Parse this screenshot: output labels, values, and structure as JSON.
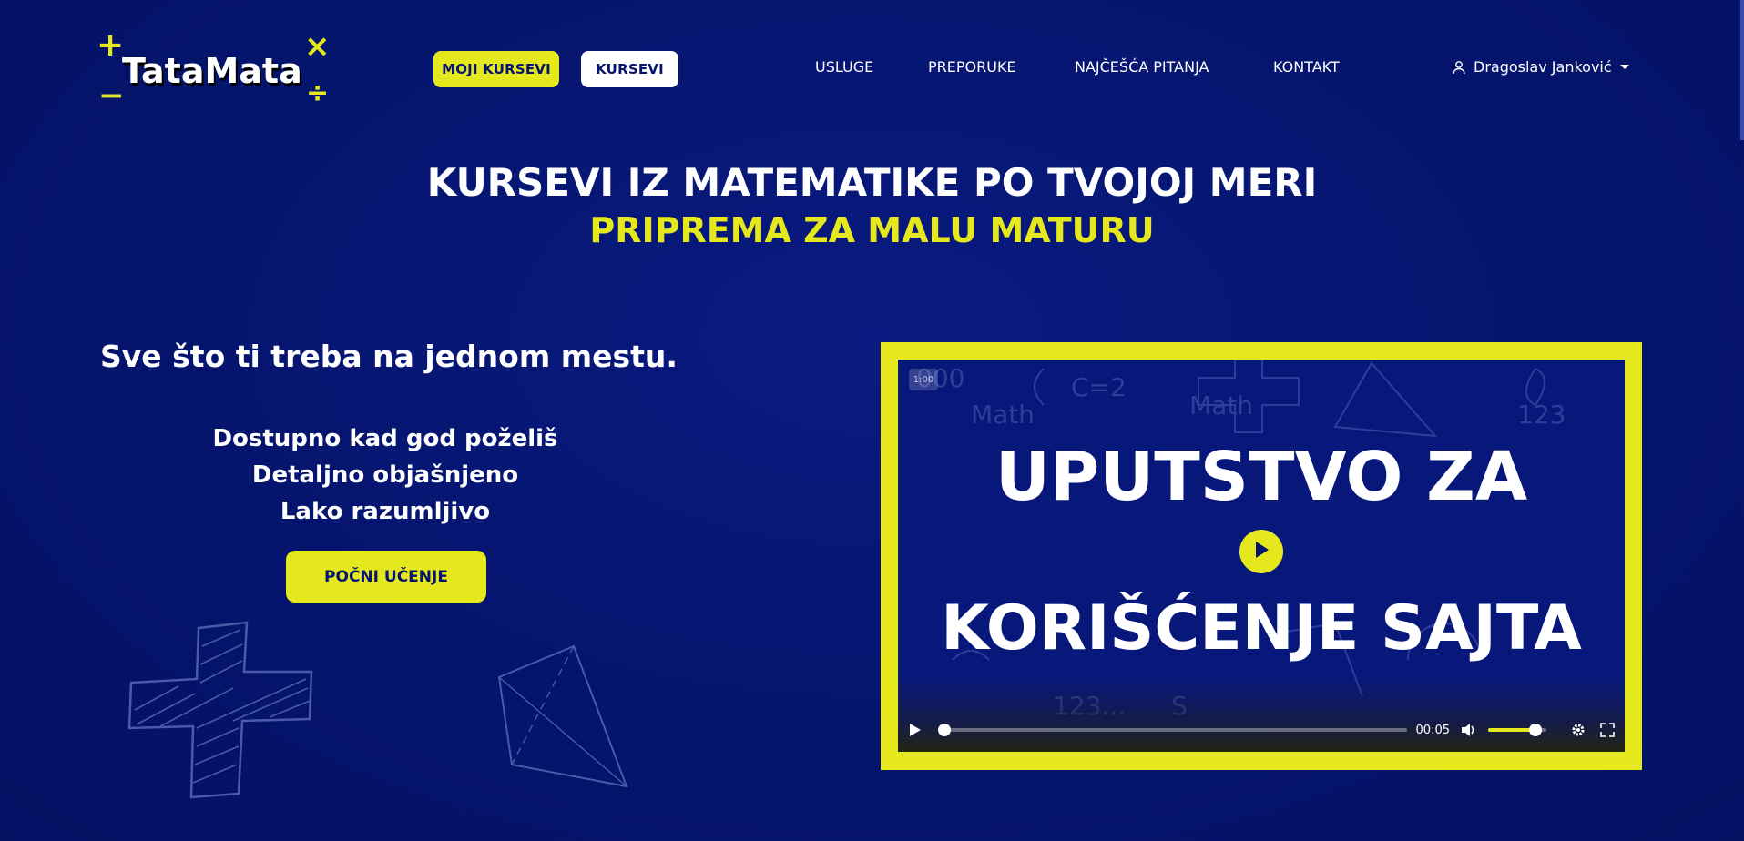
{
  "header": {
    "logo_text": "TataMata",
    "logo_symbols": {
      "plus": "+",
      "minus": "−",
      "times": "×",
      "divide": "÷"
    },
    "buttons": {
      "moji_kursevi": "MOJI KURSEVI",
      "kursevi": "KURSEVI"
    },
    "nav": [
      "USLUGE",
      "PREPORUKE",
      "NAJČEŠĆA PITANJA",
      "KONTAKT"
    ],
    "user_name": "Dragoslav Janković"
  },
  "hero": {
    "title": "KURSEVI IZ MATEMATIKE PO TVOJOJ MERI",
    "subtitle": "PRIPREMA ZA MALU MATURU"
  },
  "left": {
    "tagline": "Sve što ti treba na jednom mestu.",
    "features": [
      "Dostupno kad god poželiš",
      "Detaljno objašnjeno",
      "Lako razumljivo"
    ],
    "cta": "POČNI UČENJE"
  },
  "video": {
    "title_line1": "UPUTSTVO ZA",
    "title_line2": "KORIŠĆENJE SAJTA",
    "badge": "1:00",
    "time": "00:05",
    "progress": 0.01,
    "volume": 0.82
  },
  "colors": {
    "background": "#05156e",
    "accent": "#e4e81c",
    "text": "#ffffff"
  }
}
